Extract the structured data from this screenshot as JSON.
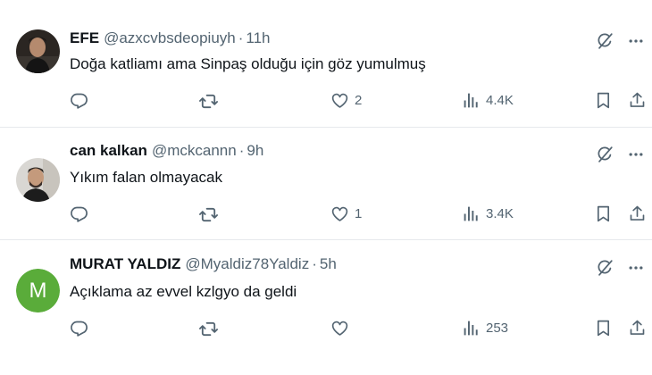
{
  "tweets": [
    {
      "name": "EFE",
      "handle": "@azxcvbsdeopiuyh",
      "dot": "·",
      "time": "11h",
      "text": "Doğa katliamı ama Sinpaş olduğu için göz yumulmuş",
      "replies": "",
      "retweets": "",
      "likes": "2",
      "views": "4.4K",
      "avatar": "photo"
    },
    {
      "name": "can kalkan",
      "handle": "@mckcannn",
      "dot": "·",
      "time": "9h",
      "text": "Yıkım falan olmayacak",
      "replies": "",
      "retweets": "",
      "likes": "1",
      "views": "3.4K",
      "avatar": "photo"
    },
    {
      "name": "MURAT YALDIZ",
      "handle": "@Myaldiz78Yaldiz",
      "dot": "·",
      "time": "5h",
      "text": "Açıklama az evvel kzlgyo da geldi",
      "replies": "",
      "retweets": "",
      "likes": "",
      "views": "253",
      "avatar_letter": "M",
      "avatar_color": "#5aac3a"
    }
  ],
  "colors": {
    "text": "#0f1419",
    "muted": "#536471",
    "divider": "#e6e9ec"
  },
  "icons": [
    "grok-icon",
    "more-icon",
    "reply-icon",
    "retweet-icon",
    "like-icon",
    "views-icon",
    "bookmark-icon",
    "share-icon"
  ]
}
